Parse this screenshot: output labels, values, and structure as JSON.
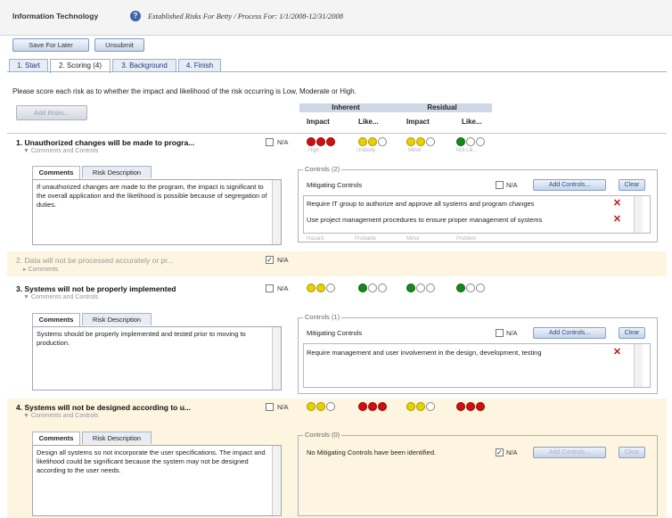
{
  "header": {
    "title": "Information Technology",
    "help_icon": "?",
    "subtitle": "Established Risks For Betty / Process For: 1/1/2008-12/31/2008"
  },
  "toolbar": {
    "save_later": "Save For Later",
    "unsubmit": "Unsubmit"
  },
  "tabs": [
    {
      "label": "1. Start"
    },
    {
      "label": "2. Scoring (4)"
    },
    {
      "label": "3. Background"
    },
    {
      "label": "4. Finish"
    }
  ],
  "instructions": "Please score each risk as to whether the impact and likelihood of the risk occurring is Low, Moderate or High.",
  "add_risks_button": "Add Risks...",
  "columns": {
    "inherent": "Inherent",
    "residual": "Residual",
    "impact": "Impact",
    "likelihood": "Like..."
  },
  "common": {
    "na": "N/A",
    "comments_and_controls": "Comments and Controls",
    "comments": "Comments",
    "comments_tab": "Comments",
    "risk_description_tab": "Risk Description",
    "mitigating_controls": "Mitigating Controls",
    "add_controls": "Add Controls...",
    "clear": "Clear"
  },
  "dot_labels": {
    "high": "High",
    "unlikely": "Unlikely",
    "minor": "Minor",
    "not_likely": "Not Lik..."
  },
  "dot_labels_row1b": {
    "high": "Hazard",
    "probable": "Probable",
    "minor": "Minor",
    "problem": "Problem"
  },
  "risks": [
    {
      "title": "1. Unauthorized changes will be made to progra...",
      "na_checked": false,
      "inherent_impact": "high",
      "inherent_likelihood": "moderate",
      "residual_impact": "moderate",
      "residual_likelihood": "low",
      "comment": "If unauthorized changes are made to the program, the impact is significant to the overall application and the likelihood is possible because of segregation of duties.",
      "controls_legend": "Controls (2)",
      "controls_na": false,
      "controls": [
        "Require IT group to authorize and approve all systems and program changes",
        "Use project management procedures to ensure proper management of systems"
      ]
    },
    {
      "title": "2. Data will not be processed accurately or pr...",
      "na_checked": true,
      "subtitle": "Comments"
    },
    {
      "title": "3. Systems will not be properly implemented",
      "na_checked": false,
      "inherent_impact": "moderate",
      "inherent_likelihood": "low",
      "residual_impact": "low",
      "residual_likelihood": "low",
      "comment": "Systems should be properly implemented and tested prior to moving to production.",
      "controls_legend": "Controls (1)",
      "controls_na": false,
      "controls": [
        "Require management and user involvement in the design, development, testing"
      ]
    },
    {
      "title": "4. Systems will not be designed according to u...",
      "na_checked": false,
      "inherent_impact": "moderate",
      "inherent_likelihood": "high",
      "residual_impact": "moderate",
      "residual_likelihood": "high",
      "comment": "Design all systems so not incorporate the user specifications.  The impact and likelihood could be significant because the system may not be designed according to the user needs.",
      "controls_legend": "Controls (0)",
      "controls_na": true,
      "no_controls": "No Mitigating Controls have been identified."
    }
  ],
  "colors": {
    "red": "#cc1111",
    "yellow": "#e6d200",
    "green": "#138a1b",
    "highlight": "#fdf5df"
  }
}
